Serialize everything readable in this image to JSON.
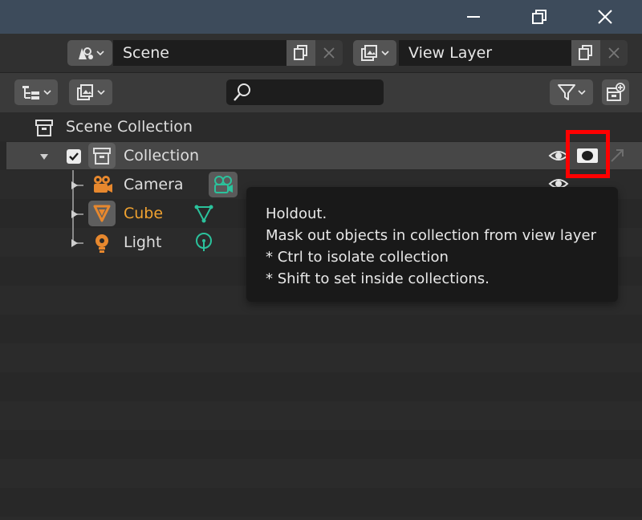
{
  "window": {
    "buttons": [
      "minimize",
      "maximize",
      "close"
    ]
  },
  "topbar": {
    "scene": {
      "icon": "scene-icon",
      "value": "Scene"
    },
    "view_layer": {
      "icon": "render-layers-icon",
      "value": "View Layer"
    }
  },
  "outliner_header": {
    "display_mode_icon": "outliner-icon",
    "filter_icon": "funnel-icon",
    "search": {
      "placeholder": "",
      "value": ""
    }
  },
  "tree": {
    "root": {
      "label": "Scene Collection"
    },
    "collection": {
      "label": "Collection",
      "checked": true
    },
    "objects": [
      {
        "label": "Camera",
        "color": "#dedede",
        "data_icon": "camera-data-icon"
      },
      {
        "label": "Cube",
        "color": "#f0a230",
        "data_icon": "mesh-data-icon"
      },
      {
        "label": "Light",
        "color": "#dedede",
        "data_icon": "light-data-icon"
      }
    ]
  },
  "tooltip": {
    "title": "Holdout.",
    "line1": "Mask out objects in collection from view layer",
    "line2": "* Ctrl to isolate collection",
    "line3": "* Shift to set inside collections."
  },
  "colors": {
    "accent_orange": "#e7882e",
    "data_teal": "#2bc29c",
    "highlight": "#ff0000",
    "titlebar": "#3d4b5b"
  }
}
